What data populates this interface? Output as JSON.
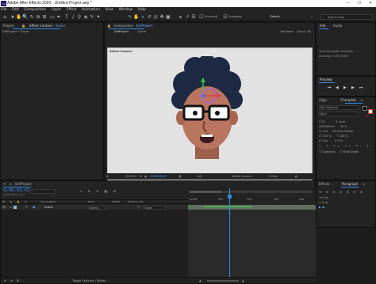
{
  "window": {
    "title": "Adobe After Effects 2020 - Untitled Project.aep *",
    "app_icon": "Ae",
    "minimize": "—",
    "maximize": "☐",
    "close": "✕"
  },
  "menu": [
    "File",
    "Edit",
    "Composition",
    "Layer",
    "Effect",
    "Animation",
    "View",
    "Window",
    "Help"
  ],
  "toolbar": {
    "universal_label": "Universal",
    "snapping_label": "Snapping",
    "default_label": "Default",
    "search_placeholder": "Search Help"
  },
  "left_panel": {
    "project_tab": "Project",
    "effect_controls_tab": "Effect Controls",
    "effect_controls_target": "Scene",
    "breadcrumb": "DefProject • Scene"
  },
  "composition": {
    "tab_label": "Composition",
    "tab_comp_name": "DefProject",
    "subtab_active": "DefProject",
    "subtab_inactive": "Scene",
    "renderer_label": "Renderer:",
    "renderer_value": "Classic 3D",
    "overlay_label": "Active Camera",
    "footer": {
      "zoom": "(50.9%)",
      "timecode": "0;00;03;03",
      "resolution": "Full",
      "camera": "Active Camera",
      "views": "1 View"
    }
  },
  "right_panel": {
    "info_tab": "Info",
    "audio_tab": "Audio",
    "tracker_title": "Time Navigator Brackets",
    "tracker_value": "Duration: 0;00;30;00",
    "preview_tab": "Preview",
    "preview_controls": [
      "⏮",
      "◀",
      "▶",
      "▶",
      "⏭"
    ],
    "align_tab": "Align",
    "character_tab": "Character",
    "paragraph_tab": "Paragraph",
    "font_name": "Bar Moderna",
    "font_style": "Bold",
    "ligatures_label": "Ligatures",
    "hindi_digits_label": "Hindi Digits",
    "effects_tab": "Effects",
    "font_size": "12",
    "tracking": "0",
    "kerning_value": "Metrics",
    "leading_value": "Auto",
    "scale_h": "100 %",
    "scale_v": "100 %",
    "baseline": "0 px",
    "tsume": "0 %",
    "stroke_width": "1 px",
    "stroke_type": "Fill Over Stroke",
    "para_indent": "0 px",
    "para_space": "0 px",
    "colors": {
      "fill": "#000000",
      "stroke": "#ffffff",
      "accent": "#2d8ceb",
      "highlight": "#d93a3a"
    }
  },
  "timeline": {
    "tab_label": "DefProject",
    "timecode": "0;00;03;03",
    "frames": "00093 (29.97 fps)",
    "search_placeholder": "",
    "columns": {
      "num": "#",
      "source": "Source Name",
      "mode": "Mode",
      "trkmat": "TrkMat",
      "parent": "Parent & Link"
    },
    "layer": {
      "index": "1",
      "name": "Scene",
      "mode": "Norma",
      "trkmat": "",
      "parent": "None"
    },
    "ruler": [
      "0:00s",
      "05s",
      "10s",
      "15s",
      "20s"
    ],
    "toggle_label": "Toggle Switches / Modes"
  },
  "character": {
    "skin": "#b97560",
    "hair": "#1e2a44",
    "glasses": "#111111",
    "eyes": "#ffffff",
    "mouth": "#3a1a1a"
  }
}
